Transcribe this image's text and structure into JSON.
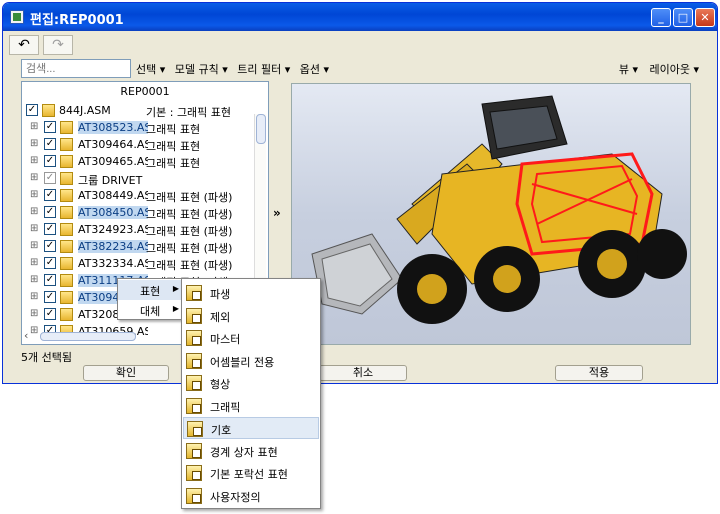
{
  "window": {
    "title": "편집:REP0001",
    "minimize": "_",
    "maximize": "□",
    "close": "✕"
  },
  "toolbar": {
    "undo": "↶",
    "redo": "↷"
  },
  "search": {
    "placeholder": "검색..."
  },
  "menus": {
    "left": [
      "선택 ▾",
      "모델 규칙 ▾",
      "트리 필터 ▾",
      "옵션 ▾"
    ],
    "right": [
      "뷰 ▾",
      "레이아웃 ▾"
    ]
  },
  "tree": {
    "header": "REP0001",
    "rows": [
      {
        "name": "844J.ASM",
        "rep": "기본 : 그래픽 표현",
        "selected": false
      },
      {
        "name": "AT308523.AS",
        "rep": "그래픽 표현",
        "selected": true
      },
      {
        "name": "AT309464.AS",
        "rep": "그래픽 표현",
        "selected": false
      },
      {
        "name": "AT309465.AS",
        "rep": "그래픽 표현",
        "selected": false
      },
      {
        "name": "그룹 DRIVET",
        "rep": "",
        "selected": false
      },
      {
        "name": "AT308449.AS",
        "rep": "그래픽 표현 (파생)",
        "selected": false
      },
      {
        "name": "AT308450.AS",
        "rep": "그래픽 표현 (파생)",
        "selected": true
      },
      {
        "name": "AT324923.AS",
        "rep": "그래픽 표현 (파생)",
        "selected": false
      },
      {
        "name": "AT382234.AS",
        "rep": "그래픽 표현 (파생)",
        "selected": true
      },
      {
        "name": "AT332334.AS",
        "rep": "그래픽 표현 (파생)",
        "selected": false
      },
      {
        "name": "AT311117.AS",
        "rep": "그래픽 표현 (파생)",
        "selected": true
      },
      {
        "name": "AT309456.AS",
        "rep": "",
        "selected": true
      },
      {
        "name": "AT320856.AS",
        "rep": "",
        "selected": false
      },
      {
        "name": "AT310659.AS",
        "rep": "",
        "selected": false
      }
    ]
  },
  "status": "5개 선택됨",
  "buttons": {
    "ok": "확인",
    "cancel": "취소",
    "apply": "적용"
  },
  "expand_arrow": "»",
  "context_menu": {
    "items": [
      {
        "label": "표현",
        "arrow": "▶"
      },
      {
        "label": "대체",
        "arrow": "▶"
      }
    ]
  },
  "rep_menu": {
    "items": [
      "파생",
      "제외",
      "마스터",
      "어셈블리 전용",
      "형상",
      "그래픽",
      "기호",
      "경계 상자 표현",
      "기본 포락선 표현",
      "사용자정의"
    ]
  }
}
